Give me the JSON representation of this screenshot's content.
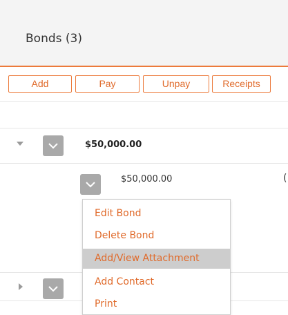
{
  "header": {
    "title": "Bonds  (3)"
  },
  "toolbar": {
    "add_label": "Add",
    "pay_label": "Pay",
    "unpay_label": "Unpay",
    "receipts_label": "Receipts"
  },
  "bonds": {
    "row1": {
      "amount": "$50,000.00",
      "expanded": true
    },
    "detail": {
      "amount": "$50,000.00",
      "trailing_text": "("
    },
    "row2": {
      "expanded": false
    }
  },
  "context_menu": {
    "items": [
      {
        "label": "Edit Bond",
        "highlighted": false
      },
      {
        "label": "Delete Bond",
        "highlighted": false
      },
      {
        "label": "Add/View Attachment",
        "highlighted": true
      },
      {
        "label": "Add Contact",
        "highlighted": false
      },
      {
        "label": "Print",
        "highlighted": false
      }
    ]
  },
  "icons": {
    "expand_down": "caret-down-icon",
    "expand_right": "caret-right-icon",
    "dropdown": "chevron-down-icon"
  },
  "colors": {
    "accent": "#ec7a3b",
    "menu_text": "#e06a2a",
    "dropdown_bg": "#a9a9a9",
    "highlight_bg": "#cdcdcd",
    "header_bg": "#f4f4f4"
  }
}
